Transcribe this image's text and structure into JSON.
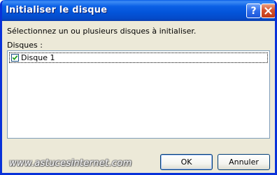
{
  "window": {
    "title": "Initialiser le disque",
    "help_glyph": "?",
    "colors": {
      "titlebar": "#0354D9",
      "face": "#ECE9D8",
      "close": "#D6522D"
    }
  },
  "dialog": {
    "instruction": "Sélectionnez un ou plusieurs disques à initialiser.",
    "disks_label": "Disques :",
    "disks": [
      {
        "label": "Disque 1",
        "checked": true
      }
    ]
  },
  "watermark": "www.astucesinternet.com",
  "buttons": {
    "ok": "OK",
    "cancel": "Annuler"
  }
}
